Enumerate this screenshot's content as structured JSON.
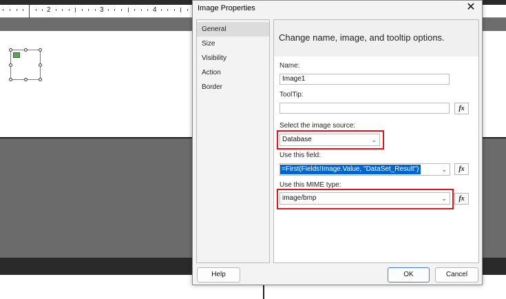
{
  "background": {
    "ruler_numbers": [
      "2",
      "3",
      "4"
    ]
  },
  "dialog": {
    "title": "Image Properties",
    "close_glyph": "✕",
    "nav": [
      "General",
      "Size",
      "Visibility",
      "Action",
      "Border"
    ],
    "header": "Change name, image, and tooltip options.",
    "name_label": "Name:",
    "name_value": "Image1",
    "tooltip_label": "ToolTip:",
    "tooltip_value": "",
    "source_label": "Select the image source:",
    "source_value": "Database",
    "field_label": "Use this field:",
    "field_value": "=First(Fields!Image.Value, \"DataSet_Result\")",
    "mime_label": "Use this MIME type:",
    "mime_value": "image/bmp",
    "fx_label": "fx",
    "help_label": "Help",
    "ok_label": "OK",
    "cancel_label": "Cancel"
  },
  "colors": {
    "highlight_box": "#e0141e",
    "selection": "#0066cc",
    "primary_border": "#3b7fd9"
  },
  "icons": {
    "dropdown": "chevron-down-icon",
    "close": "close-icon",
    "expression": "fx-icon"
  }
}
